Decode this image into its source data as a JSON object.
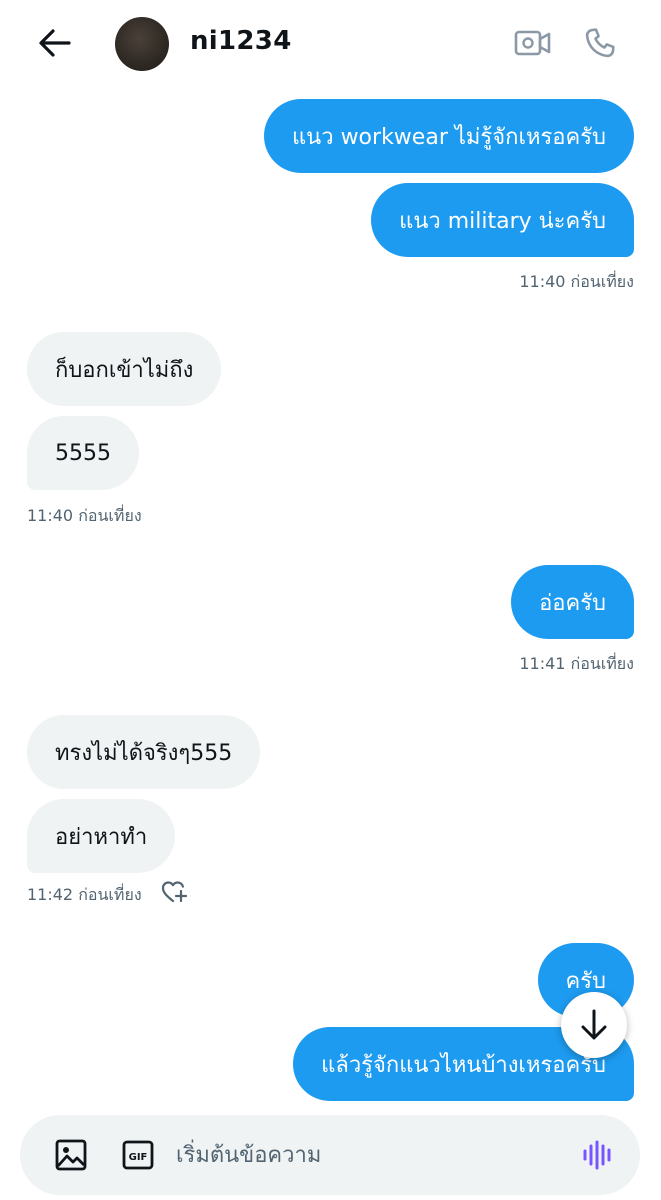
{
  "header": {
    "username": "ni1234",
    "icons": {
      "back": "arrow-left-icon",
      "video": "video-camera-icon",
      "call": "phone-icon"
    }
  },
  "messages": [
    {
      "side": "out",
      "text": "แนว workwear ไม่รู้จักเหรอครับ"
    },
    {
      "side": "out",
      "text": "แนว military น่ะครับ",
      "time": "11:40 ก่อนเที่ยง"
    },
    {
      "side": "in",
      "text": "ก็บอกเข้าไม่ถึง"
    },
    {
      "side": "in",
      "text": "5555",
      "time": "11:40 ก่อนเที่ยง"
    },
    {
      "side": "out",
      "text": "อ่อครับ",
      "time": "11:41 ก่อนเที่ยง"
    },
    {
      "side": "in",
      "text": "ทรงไม่ได้จริงๆ555"
    },
    {
      "side": "in",
      "text": "อย่าหาทำ",
      "time": "11:42 ก่อนเที่ยง"
    },
    {
      "side": "out",
      "text": "ครับ"
    },
    {
      "side": "out",
      "text": "แล้วรู้จักแนวไหนบ้างเหรอครับ"
    }
  ],
  "composer": {
    "placeholder": "เริ่มต้นข้อความ",
    "icons": {
      "image": "image-icon",
      "gif": "gif-icon",
      "voice": "voice-wave-icon"
    },
    "gif_label": "GIF"
  },
  "colors": {
    "accent": "#1d9bf0",
    "incoming_bg": "#eff3f4",
    "muted_text": "#536471",
    "voice_icon": "#7856ff"
  }
}
